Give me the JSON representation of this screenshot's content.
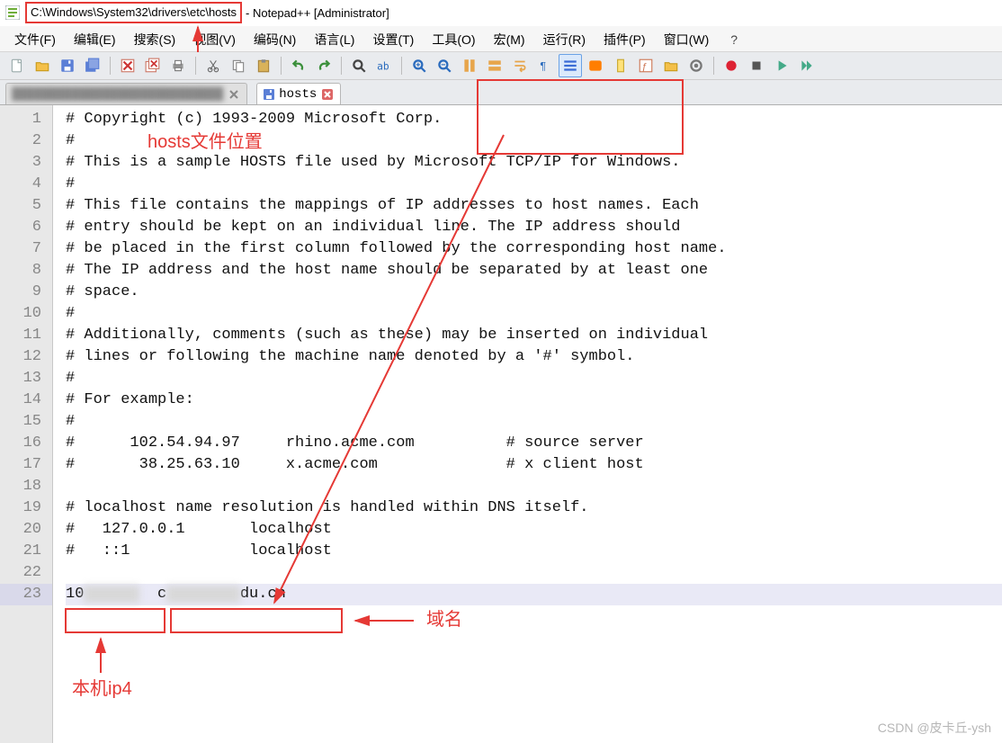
{
  "title": {
    "path": "C:\\Windows\\System32\\drivers\\etc\\hosts",
    "suffix": " - Notepad++ [Administrator]"
  },
  "menus": {
    "file": "文件(F)",
    "edit": "编辑(E)",
    "search": "搜索(S)",
    "view": "视图(V)",
    "encode": "编码(N)",
    "lang": "语言(L)",
    "setting": "设置(T)",
    "tools": "工具(O)",
    "macro": "宏(M)",
    "run": "运行(R)",
    "plugin": "插件(P)",
    "window": "窗口(W)",
    "help": "?"
  },
  "tabs": {
    "blurred_tab_placeholder": "████████████████████████████",
    "active_label": "hosts"
  },
  "code_lines": [
    "# Copyright (c) 1993-2009 Microsoft Corp.",
    "#",
    "# This is a sample HOSTS file used by Microsoft TCP/IP for Windows.",
    "#",
    "# This file contains the mappings of IP addresses to host names. Each",
    "# entry should be kept on an individual line. The IP address should",
    "# be placed in the first column followed by the corresponding host name.",
    "# The IP address and the host name should be separated by at least one",
    "# space.",
    "#",
    "# Additionally, comments (such as these) may be inserted on individual",
    "# lines or following the machine name denoted by a '#' symbol.",
    "#",
    "# For example:",
    "#",
    "#      102.54.94.97     rhino.acme.com          # source server",
    "#       38.25.63.10     x.acme.com              # x client host",
    "",
    "# localhost name resolution is handled within DNS itself.",
    "#   127.0.0.1       localhost",
    "#   ::1             localhost",
    ""
  ],
  "line23": {
    "ip_prefix": "10",
    "ip_blur": "██████",
    "host_prefix": "c",
    "host_blur": "████████",
    "host_suffix": "du.cn"
  },
  "annotations": {
    "hosts_path": "hosts文件位置",
    "domain_label": "域名",
    "ipv4_label": "本机ip4"
  },
  "watermark": "CSDN @皮卡丘-ysh"
}
